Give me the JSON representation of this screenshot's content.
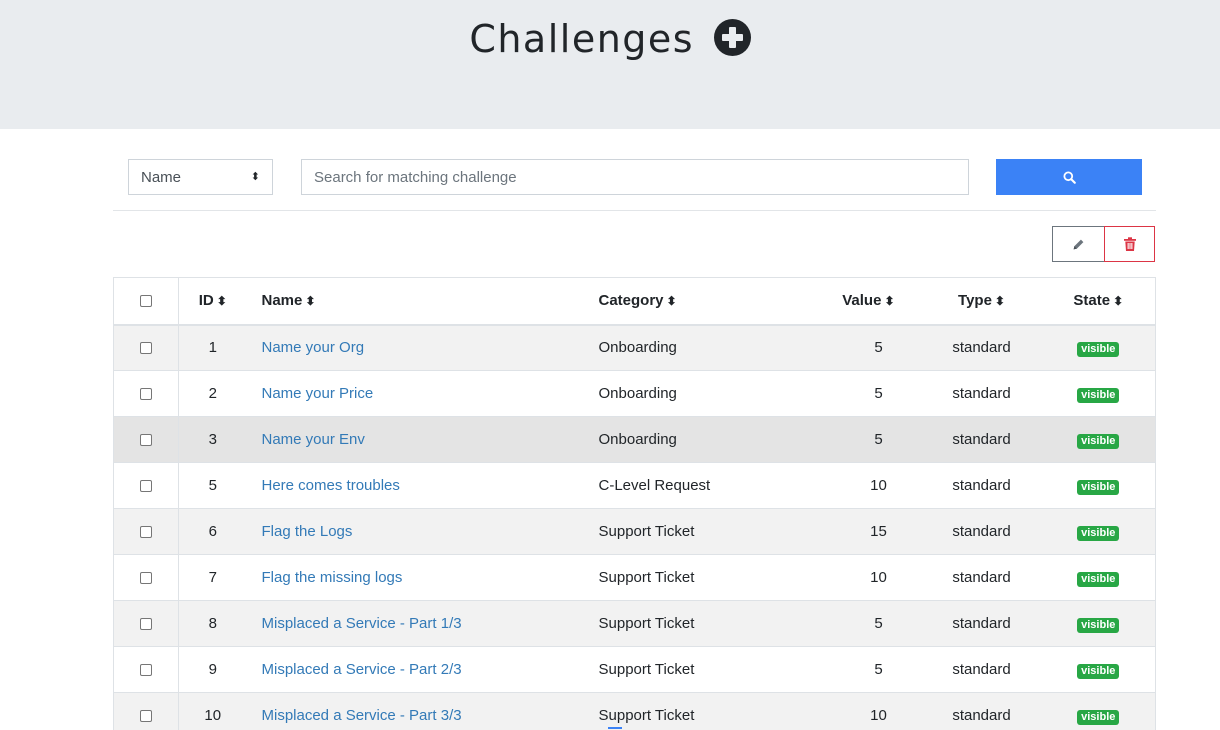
{
  "header": {
    "title": "Challenges",
    "add_icon": "plus-circle-icon"
  },
  "search": {
    "field_selected": "Name",
    "placeholder": "Search for matching challenge",
    "value": "",
    "button_icon": "search-icon"
  },
  "toolbar": {
    "edit_icon": "pencil-icon",
    "delete_icon": "trash-icon"
  },
  "table": {
    "columns": [
      "ID",
      "Name",
      "Category",
      "Value",
      "Type",
      "State"
    ],
    "rows": [
      {
        "id": "1",
        "name": "Name your Org",
        "category": "Onboarding",
        "value": "5",
        "type": "standard",
        "state": "visible"
      },
      {
        "id": "2",
        "name": "Name your Price",
        "category": "Onboarding",
        "value": "5",
        "type": "standard",
        "state": "visible"
      },
      {
        "id": "3",
        "name": "Name your Env",
        "category": "Onboarding",
        "value": "5",
        "type": "standard",
        "state": "visible"
      },
      {
        "id": "5",
        "name": "Here comes troubles",
        "category": "C-Level Request",
        "value": "10",
        "type": "standard",
        "state": "visible"
      },
      {
        "id": "6",
        "name": "Flag the Logs",
        "category": "Support Ticket",
        "value": "15",
        "type": "standard",
        "state": "visible"
      },
      {
        "id": "7",
        "name": "Flag the missing logs",
        "category": "Support Ticket",
        "value": "10",
        "type": "standard",
        "state": "visible"
      },
      {
        "id": "8",
        "name": "Misplaced a Service - Part 1/3",
        "category": "Support Ticket",
        "value": "5",
        "type": "standard",
        "state": "visible"
      },
      {
        "id": "9",
        "name": "Misplaced a Service - Part 2/3",
        "category": "Support Ticket",
        "value": "5",
        "type": "standard",
        "state": "visible"
      },
      {
        "id": "10",
        "name": "Misplaced a Service - Part 3/3",
        "category": "Support Ticket",
        "value": "10",
        "type": "standard",
        "state": "visible"
      }
    ]
  },
  "colors": {
    "accent": "#3b82f6",
    "link": "#337ab7",
    "badge": "#28a745",
    "danger": "#dc3545",
    "header_bg": "#e9ecef"
  }
}
